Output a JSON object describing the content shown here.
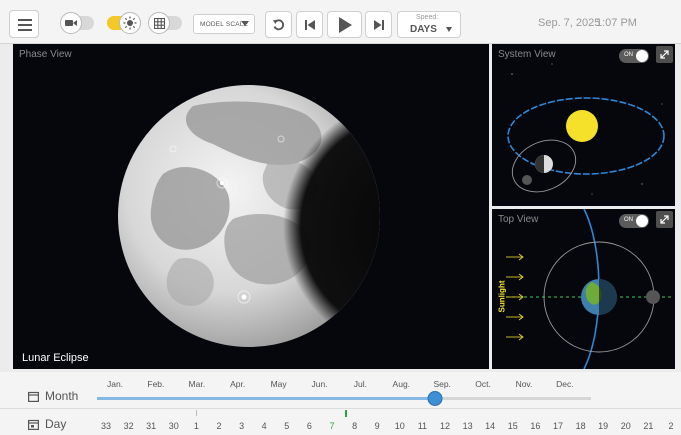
{
  "toolbar": {
    "scale_label": "MODEL SCALE",
    "speed_label": "Speed:",
    "speed_value": "DAYS",
    "date": "Sep. 7, 2025",
    "time": "1:07 PM"
  },
  "panels": {
    "phase": {
      "title": "Phase View",
      "caption": "Lunar Eclipse"
    },
    "system": {
      "title": "System View",
      "toggle": "ON"
    },
    "top": {
      "title": "Top View",
      "toggle": "ON",
      "sunlight_label": "Sunlight"
    }
  },
  "timeline": {
    "month_label": "Month",
    "day_label": "Day",
    "months": [
      "Jan.",
      "Feb.",
      "Mar.",
      "Apr.",
      "May",
      "Jun.",
      "Jul.",
      "Aug.",
      "Sep.",
      "Oct.",
      "Nov.",
      "Dec."
    ],
    "days": [
      "33",
      "32",
      "31",
      "30",
      "1",
      "2",
      "3",
      "4",
      "5",
      "6",
      "7",
      "8",
      "9",
      "10",
      "11",
      "12",
      "13",
      "14",
      "15",
      "16",
      "17",
      "18",
      "19",
      "20",
      "21",
      "2"
    ],
    "current_day": "7",
    "year_progress": 0.685
  },
  "colors": {
    "accent": "#3d8fd6",
    "sun": "#f5e12a",
    "orbit": "#2f86d6",
    "highlight_day": "#22a93b"
  }
}
